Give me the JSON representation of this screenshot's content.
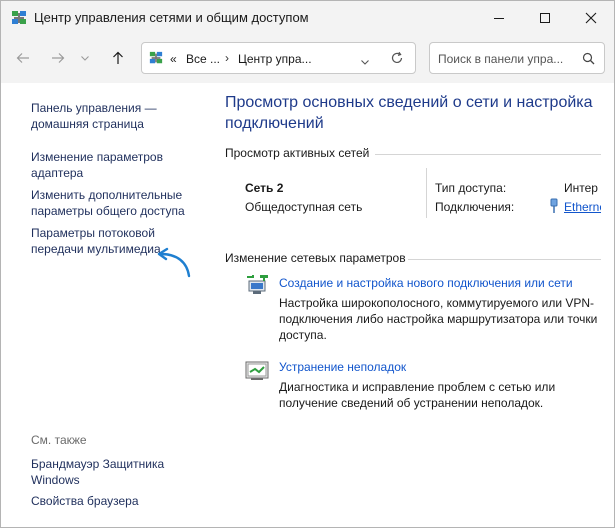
{
  "window": {
    "title": "Центр управления сетями и общим доступом"
  },
  "addressbar": {
    "overflow": "«",
    "crumbs": [
      "Все ...",
      "Центр упра..."
    ]
  },
  "search": {
    "placeholder": "Поиск в панели упра..."
  },
  "sidebar": {
    "links": [
      {
        "lines": [
          "Панель управления —",
          "домашняя страница"
        ]
      },
      {
        "lines": [
          "Изменение параметров",
          "адаптера"
        ]
      },
      {
        "lines": [
          "Изменить дополнительные",
          "параметры общего доступа"
        ]
      },
      {
        "lines": [
          "Параметры потоковой",
          "передачи мультимедиа"
        ]
      }
    ],
    "see_also": "См. также",
    "see_also_links": [
      {
        "lines": [
          "Брандмауэр Защитника",
          "Windows"
        ]
      },
      {
        "lines": [
          "Свойства браузера"
        ]
      }
    ]
  },
  "main": {
    "title": "Просмотр основных сведений о сети и настройка подключений",
    "active_networks_header": "Просмотр активных сетей",
    "network": {
      "name": "Сеть 2",
      "type": "Общедоступная сеть",
      "access_label": "Тип доступа:",
      "access_value": "Интер",
      "connections_label": "Подключения:",
      "connections_value": "Etherne"
    },
    "change_header": "Изменение сетевых параметров",
    "tasks": [
      {
        "title": "Создание и настройка нового подключения или сети",
        "desc": "Настройка широкополосного, коммутируемого или VPN-подключения либо настройка маршрутизатора или точки доступа."
      },
      {
        "title": "Устранение неполадок",
        "desc": "Диагностика и исправление проблем с сетью или получение сведений об устранении неполадок."
      }
    ]
  },
  "colors": {
    "link": "#1155cc",
    "title": "#1e3a8a",
    "annotation_arrow": "#1f7fd0"
  }
}
